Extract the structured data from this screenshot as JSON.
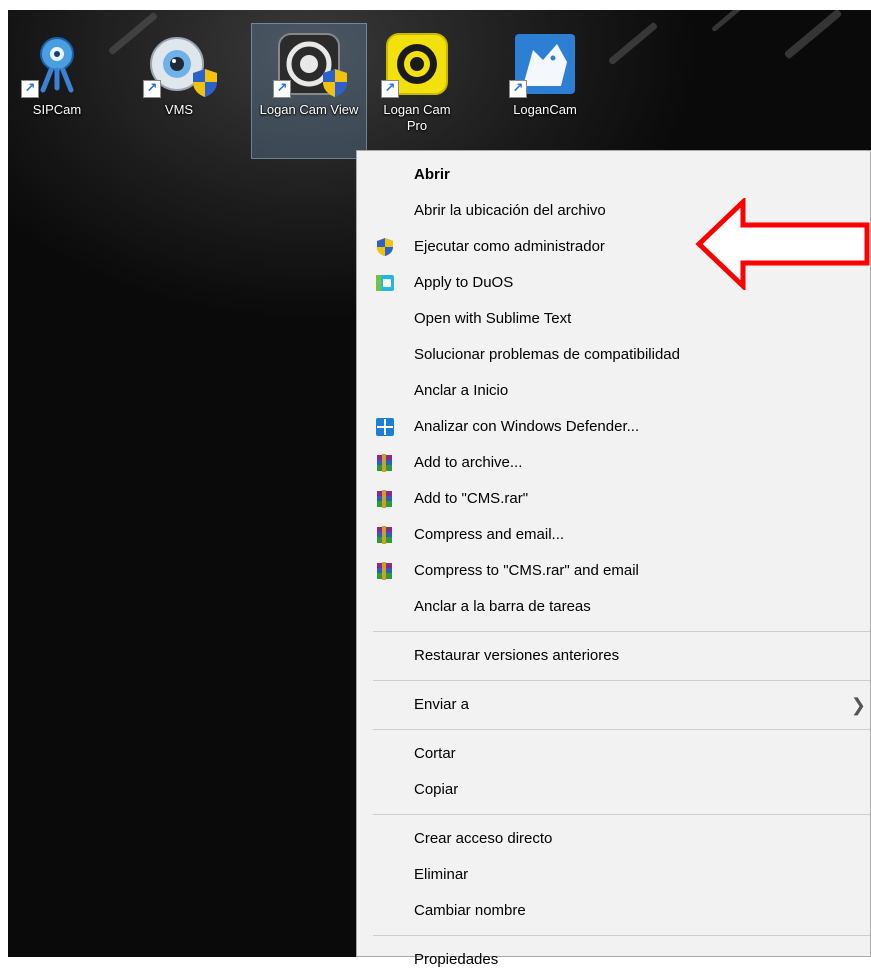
{
  "desktop": {
    "icons": [
      {
        "label": "SIPCam",
        "icon": "webcam-icon"
      },
      {
        "label": "VMS",
        "icon": "security-camera-icon"
      },
      {
        "label": "Logan Cam View",
        "icon": "logan-cam-view-icon"
      },
      {
        "label": "Logan Cam Pro",
        "icon": "logan-cam-pro-icon"
      },
      {
        "label": "LoganCam",
        "icon": "logancam-wolf-icon"
      }
    ]
  },
  "context_menu": {
    "items": [
      {
        "label": "Abrir",
        "bold": true
      },
      {
        "label": "Abrir la ubicación del archivo"
      },
      {
        "label": "Ejecutar como administrador",
        "icon": "uac-shield-icon"
      },
      {
        "label": "Apply to DuOS",
        "icon": "duos-icon"
      },
      {
        "label": "Open with Sublime Text"
      },
      {
        "label": "Solucionar problemas de compatibilidad"
      },
      {
        "label": "Anclar a Inicio"
      },
      {
        "label": "Analizar con Windows Defender...",
        "icon": "windows-defender-icon"
      },
      {
        "label": "Add to archive...",
        "icon": "winrar-icon"
      },
      {
        "label": "Add to \"CMS.rar\"",
        "icon": "winrar-icon"
      },
      {
        "label": "Compress and email...",
        "icon": "winrar-icon"
      },
      {
        "label": "Compress to \"CMS.rar\" and email",
        "icon": "winrar-icon"
      },
      {
        "label": "Anclar a la barra de tareas"
      },
      {
        "label": "Restaurar versiones anteriores"
      },
      {
        "label": "Enviar a",
        "submenu": true
      },
      {
        "label": "Cortar"
      },
      {
        "label": "Copiar"
      },
      {
        "label": "Crear acceso directo"
      },
      {
        "label": "Eliminar"
      },
      {
        "label": "Cambiar nombre"
      },
      {
        "label": "Propiedades"
      }
    ]
  },
  "colors": {
    "annotation_arrow": "#ff0000",
    "menu_background": "#f2f2f2",
    "selection_highlight": "#78a0c8"
  }
}
